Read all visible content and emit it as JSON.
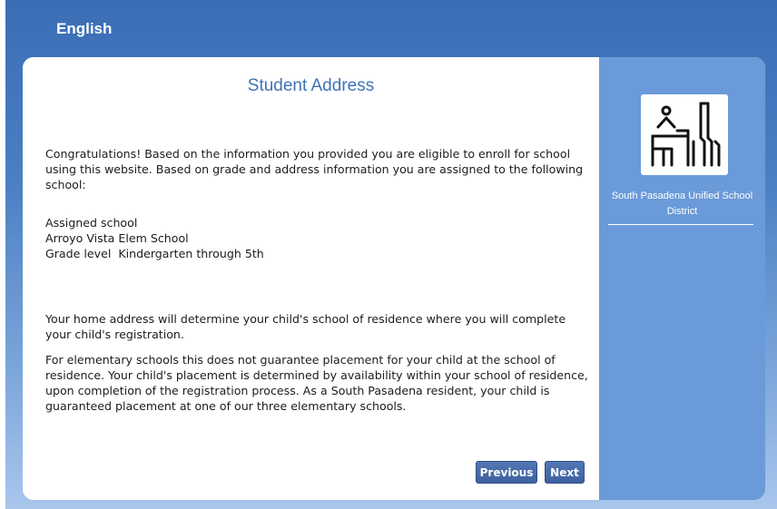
{
  "header": {
    "language": "English"
  },
  "main": {
    "title": "Student Address",
    "intro": "Congratulations! Based on the information you provided you are eligible to enroll for school using this website. Based on grade and address information you are assigned to the following school:",
    "assigned": {
      "heading": "Assigned school",
      "school": "Arroyo Vista Elem School",
      "grade_level": "Grade level  Kindergarten through 5th"
    },
    "home_address_note": "Your home address will determine your child's school of residence where you will complete your child's registration.",
    "placement_note": "For elementary schools this does not guarantee placement for your child at the school of residence.  Your child's placement is determined by availability within your school of residence, upon completion of the registration process.  As a South Pasadena resident, your child is guaranteed placement at one of our three elementary schools.",
    "buttons": {
      "previous": "Previous",
      "next": "Next"
    }
  },
  "sidebar": {
    "district_name": "South Pasadena Unified School District",
    "logo_icon": "school-district-logo-icon"
  }
}
